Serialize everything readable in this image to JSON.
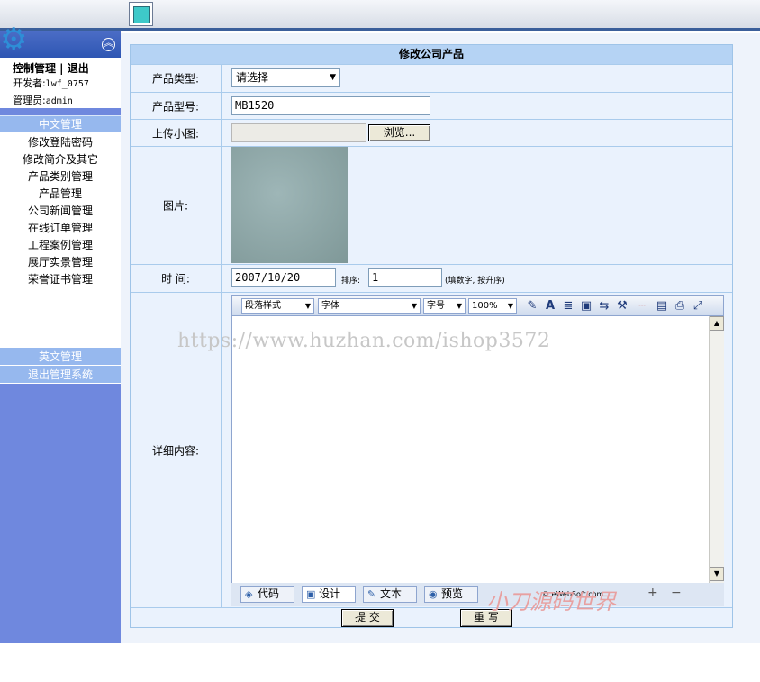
{
  "sidebar": {
    "control_title": "控制管理 | 退出",
    "developer_label": "开发者:",
    "developer_value": "lwf_0757",
    "admin_label": "管理员:",
    "admin_value": "admin",
    "section_chinese": "中文管理",
    "items": [
      {
        "label": "修改登陆密码"
      },
      {
        "label": "修改简介及其它"
      },
      {
        "label": "产品类别管理"
      },
      {
        "label": "产品管理"
      },
      {
        "label": "公司新闻管理"
      },
      {
        "label": "在线订单管理"
      },
      {
        "label": "工程案例管理"
      },
      {
        "label": "展厅实景管理"
      },
      {
        "label": "荣誉证书管理"
      }
    ],
    "section_english": "英文管理",
    "logout": "退出管理系统"
  },
  "form": {
    "title": "修改公司产品",
    "category_label": "产品类型:",
    "category_value": "请选择",
    "model_label": "产品型号:",
    "model_value": "MB1520",
    "upload_label": "上传小图:",
    "browse_button": "浏览...",
    "image_label": "图片:",
    "time_label": "时 间:",
    "time_value": "2007/10/20",
    "order_label": "排序:",
    "order_value": "1",
    "order_hint": "(填数字, 按升序)",
    "detail_label": "详细内容:",
    "submit_button": "提 交",
    "reset_button": "重 写"
  },
  "editor": {
    "style_select": "段落样式",
    "font_select": "字体",
    "size_select": "字号",
    "zoom_select": "100%",
    "mode_code": "代码",
    "mode_design": "设计",
    "mode_text": "文本",
    "mode_preview": "预览",
    "brand": "© eWebSoft.com"
  },
  "watermark": "https://www.huzhan.com/ishop3572",
  "watermark2": "小刀源码世界"
}
